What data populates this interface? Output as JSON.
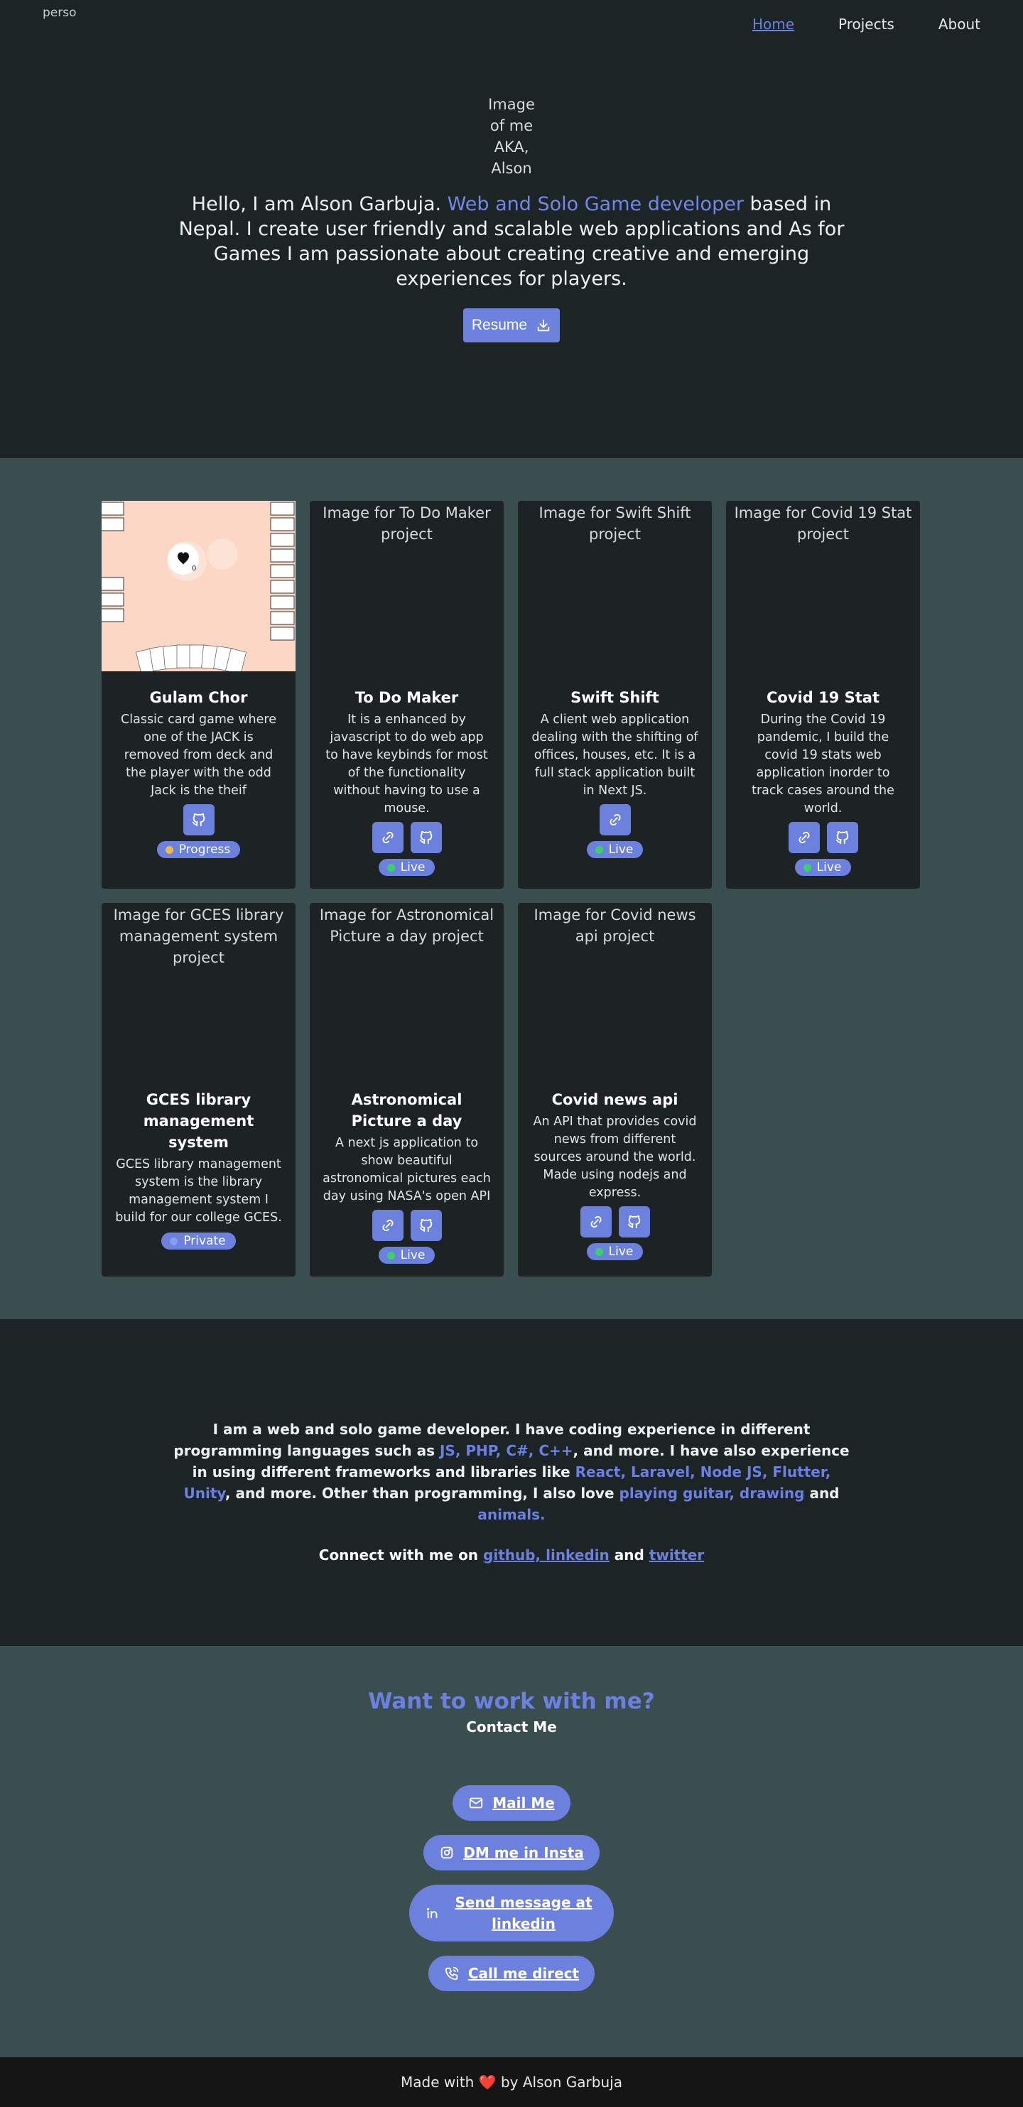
{
  "header": {
    "logo_alt": "perso",
    "nav": [
      {
        "label": "Home",
        "active": true
      },
      {
        "label": "Projects",
        "active": false
      },
      {
        "label": "About",
        "active": false
      }
    ]
  },
  "hero": {
    "image_alt": "Image of me AKA, Alson Garbuja",
    "intro_before": "Hello, I am Alson Garbuja. ",
    "intro_accent": "Web and Solo Game developer",
    "intro_after": " based in Nepal. I create user friendly and scalable web applications and As for Games I am passionate about creating creative and emerging experiences for players.",
    "resume_label": "Resume"
  },
  "projects": [
    {
      "image_alt": "",
      "has_photo": true,
      "title": "Gulam Chor",
      "desc": "Classic card game where one of the JACK is removed from deck and the player with the odd Jack is the theif",
      "links": [
        "github"
      ],
      "status": "Progress",
      "status_color": "#f5b942"
    },
    {
      "image_alt": "Image for To Do Maker project",
      "has_photo": false,
      "title": "To Do Maker",
      "desc": "It is a enhanced by javascript to do web app to have keybinds for most of the functionality without having to use a mouse.",
      "links": [
        "link",
        "github"
      ],
      "status": "Live",
      "status_color": "#3ccf6b"
    },
    {
      "image_alt": "Image for Swift Shift project",
      "has_photo": false,
      "title": "Swift Shift",
      "desc": "A client web application dealing with the shifting of offices, houses, etc. It is a full stack application built in Next JS.",
      "links": [
        "link"
      ],
      "status": "Live",
      "status_color": "#3ccf6b"
    },
    {
      "image_alt": "Image for Covid 19 Stat project",
      "has_photo": false,
      "title": "Covid 19 Stat",
      "desc": "During the Covid 19 pandemic, I build the covid 19 stats web application inorder to track cases around the world.",
      "links": [
        "link",
        "github"
      ],
      "status": "Live",
      "status_color": "#3ccf6b"
    },
    {
      "image_alt": "Image for GCES library management system project",
      "has_photo": false,
      "title": "GCES library management system",
      "desc": "GCES library management system is the library management system I build for our college GCES.",
      "links": [],
      "status": "Private",
      "status_color": "#8a9cf0"
    },
    {
      "image_alt": "Image for Astronomical Picture a day project",
      "has_photo": false,
      "title": "Astronomical Picture a day",
      "desc": "A next js application to show beautiful astronomical pictures each day using NASA's open API",
      "links": [
        "link",
        "github"
      ],
      "status": "Live",
      "status_color": "#3ccf6b"
    },
    {
      "image_alt": "Image for Covid news api project",
      "has_photo": false,
      "title": "Covid news api",
      "desc": "An API that provides covid news from different sources around the world. Made using nodejs and express.",
      "links": [
        "link",
        "github"
      ],
      "status": "Live",
      "status_color": "#3ccf6b"
    }
  ],
  "about": {
    "p1": "I am a web and solo game developer. I have coding experience in different programming languages such as ",
    "langs": "JS, PHP, C#, C++",
    "p2": ", and more. I have also experience in using different frameworks and libraries like ",
    "frameworks": "React, Laravel, Node JS, Flutter, Unity",
    "p3": ", and more. Other than programming, I also love ",
    "hobbies": "playing guitar, drawing",
    "and": " and ",
    "animals": "animals.",
    "connect_prefix": "Connect with me on ",
    "connect_links1": "github, linkedin",
    "connect_and": " and ",
    "connect_links2": "twitter"
  },
  "contact": {
    "title": "Want to work with me?",
    "subtitle": "Contact Me",
    "buttons": [
      {
        "label": "Mail Me",
        "icon": "mail-icon"
      },
      {
        "label": "DM me in Insta",
        "icon": "instagram-icon"
      },
      {
        "label": "Send message at linkedin",
        "icon": "linkedin-icon"
      },
      {
        "label": "Call me direct",
        "icon": "phone-icon"
      }
    ]
  },
  "footer": {
    "before": "Made with ",
    "heart": "❤️",
    "after": " by Alson Garbuja"
  },
  "colors": {
    "accent": "#6b81dd",
    "dark_bg": "#1c2426",
    "slate_bg": "#3a4e50"
  }
}
